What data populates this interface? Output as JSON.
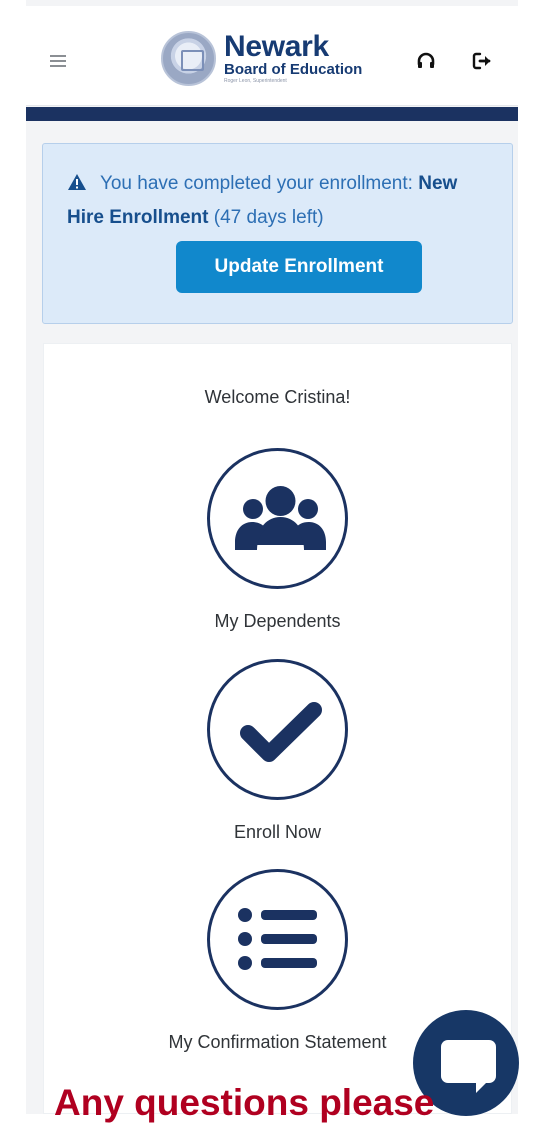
{
  "brand": {
    "name": "Newark",
    "subtitle": "Board of Education",
    "tagline": "Roger Leon, Superintendent"
  },
  "header": {
    "menu_icon": "menu-icon",
    "headphones_icon": "headphones-icon",
    "logout_icon": "logout-icon"
  },
  "alert": {
    "prefix": "You have completed your enrollment: ",
    "enrollment_name": "New Hire Enrollment",
    "suffix": " (47 days left)",
    "button_label": "Update Enrollment"
  },
  "dashboard": {
    "welcome": "Welcome Cristina!",
    "actions": [
      {
        "label": "My Dependents",
        "icon": "users-icon"
      },
      {
        "label": "Enroll Now",
        "icon": "checkmark-icon"
      },
      {
        "label": "My Confirmation Statement",
        "icon": "list-icon"
      }
    ]
  },
  "chat": {
    "icon": "chat-icon"
  },
  "footer": {
    "question": "Any questions please"
  },
  "colors": {
    "navy": "#1B3261",
    "alert_bg": "#DCEAF9",
    "alert_text": "#2D6FB4",
    "button": "#1188CC",
    "red": "#B00020"
  }
}
